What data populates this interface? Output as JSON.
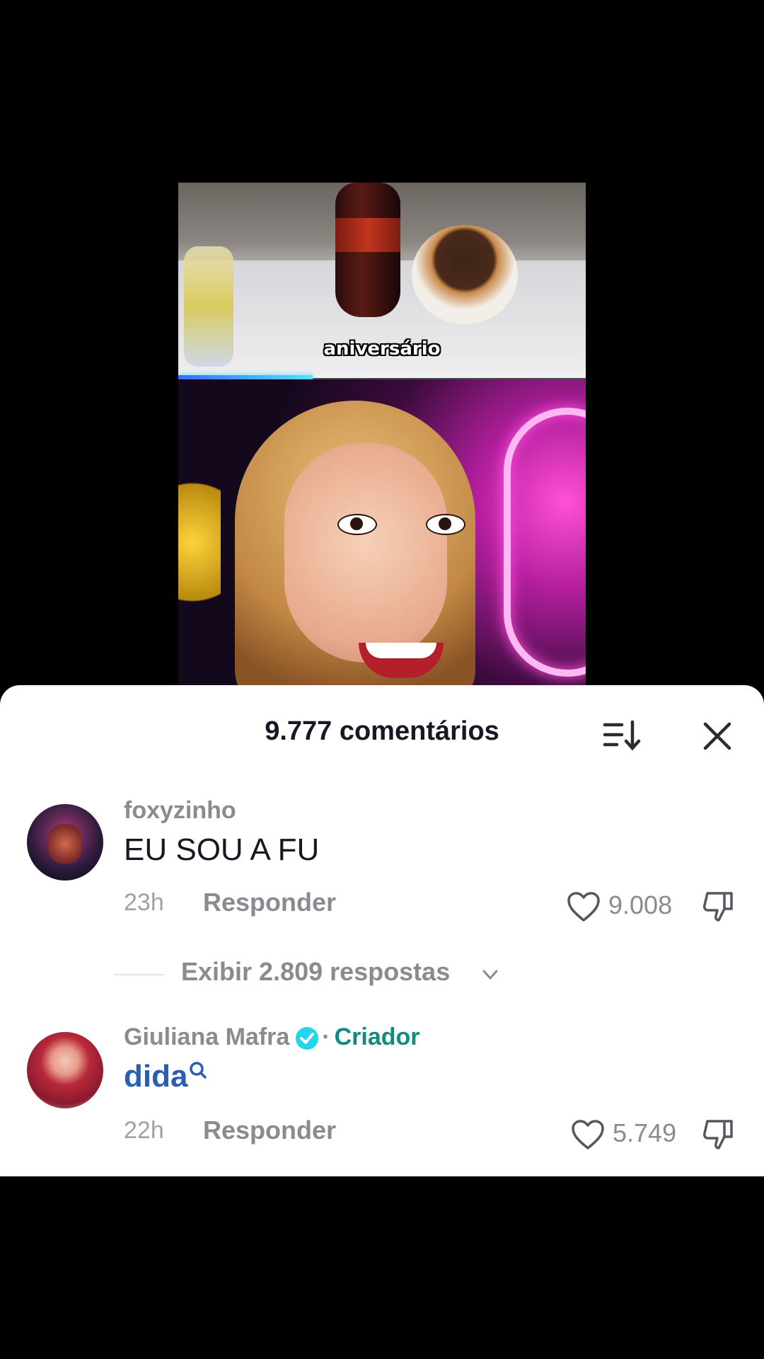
{
  "video": {
    "caption": "aniversário",
    "progress_fraction": 0.33
  },
  "sheet": {
    "title": "9.777 comentários",
    "sort_icon": "sort-icon",
    "close_icon": "close-icon"
  },
  "comments": [
    {
      "username": "foxyzinho",
      "text": "EU SOU A FU",
      "time": "23h",
      "reply_label": "Responder",
      "likes": "9.008",
      "view_replies": "Exibir 2.809 respostas"
    },
    {
      "username": "Giuliana Mafra",
      "verified": true,
      "separator": "·",
      "badge": "Criador",
      "text": "dida",
      "time": "22h",
      "reply_label": "Responder",
      "likes": "5.749"
    }
  ],
  "colors": {
    "sheet_bg": "#ffffff",
    "title": "#161823",
    "secondary": "#8a8b91",
    "creator": "#128a82",
    "link": "#2a5eb0",
    "verified": "#20d5ec"
  }
}
